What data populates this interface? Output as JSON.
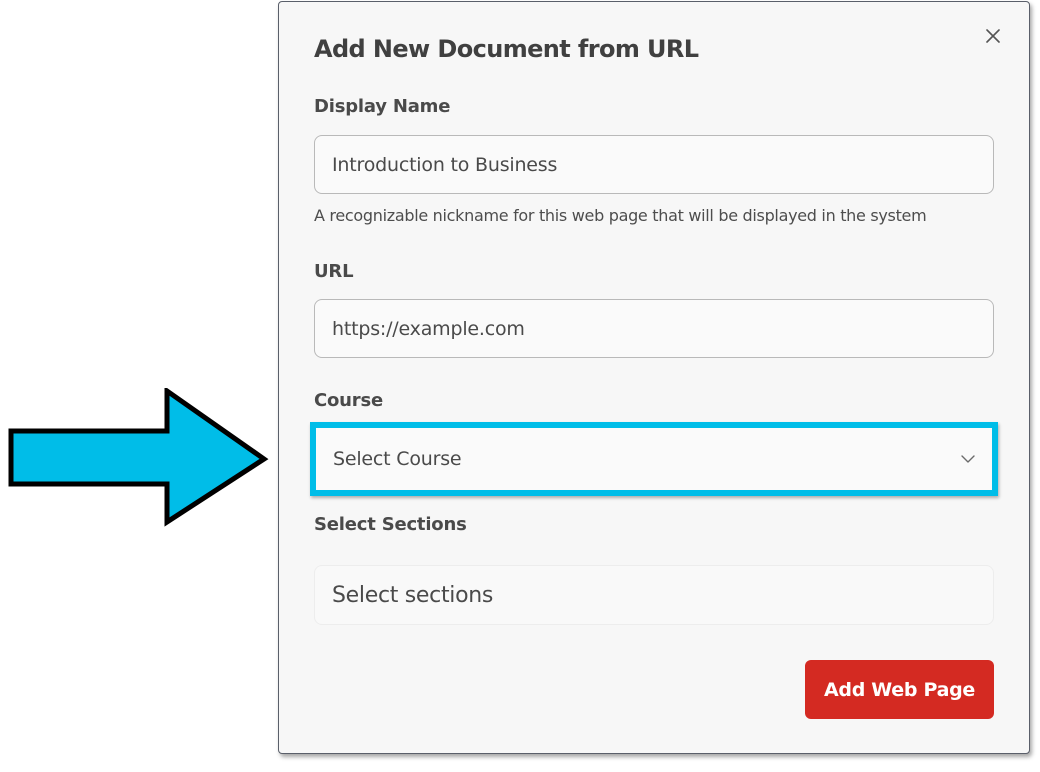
{
  "modal": {
    "title": "Add New Document from URL",
    "close_icon": "close-icon"
  },
  "display_name": {
    "label": "Display Name",
    "value": "Introduction to Business",
    "help": "A recognizable nickname for this web page that will be displayed in the system"
  },
  "url": {
    "label": "URL",
    "placeholder": "https://example.com"
  },
  "course": {
    "label": "Course",
    "selected": "Select Course",
    "icon": "chevron-down-icon"
  },
  "sections": {
    "label": "Select Sections",
    "placeholder": "Select sections"
  },
  "actions": {
    "submit_label": "Add Web Page"
  },
  "colors": {
    "highlight": "#00bde8",
    "arrow_fill": "#00bde8",
    "primary_button": "#d42a22"
  },
  "annotation": {
    "icon": "arrow-right-icon"
  }
}
